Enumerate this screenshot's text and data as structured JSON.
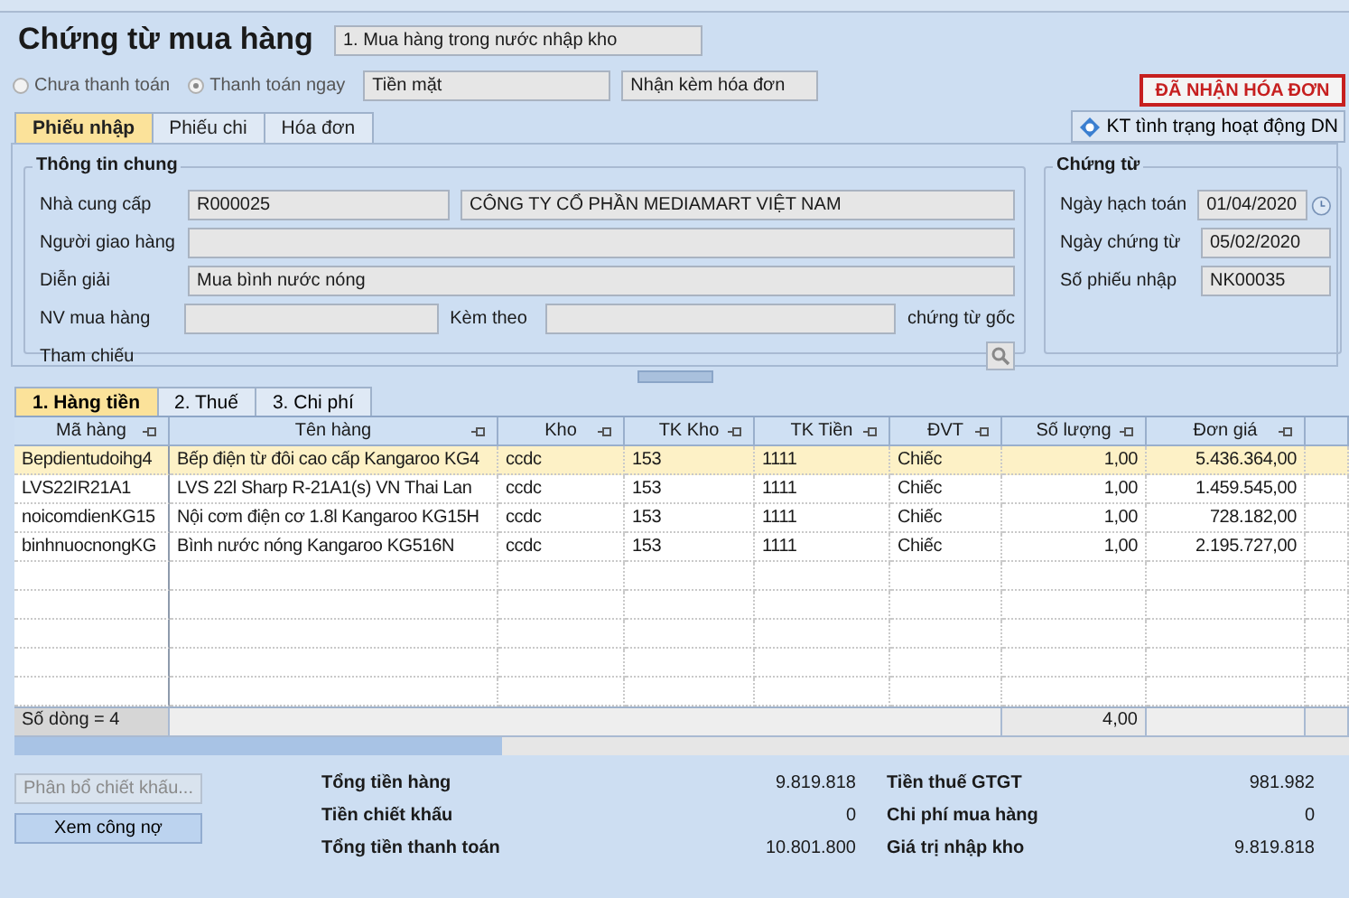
{
  "window": {
    "title": "Chứng từ mua hàng"
  },
  "voucher_type": {
    "value": "1. Mua hàng trong nước nhập kho"
  },
  "payment_options": [
    {
      "label": "Chưa thanh toán",
      "selected": false
    },
    {
      "label": "Thanh toán ngay",
      "selected": true
    }
  ],
  "payment_method": {
    "value": "Tiền mặt"
  },
  "invoice_option": {
    "value": "Nhận kèm hóa đơn"
  },
  "invoice_status_button": "ĐÃ NHẬN HÓA ĐƠN",
  "tabs": [
    {
      "label": "Phiếu nhập",
      "selected": true
    },
    {
      "label": "Phiếu chi",
      "selected": false
    },
    {
      "label": "Hóa đơn",
      "selected": false
    }
  ],
  "check_business_button": "KT tình trạng hoạt động DN",
  "general_info": {
    "title": "Thông tin chung",
    "supplier_label": "Nhà cung cấp",
    "supplier_code": "R000025",
    "supplier_name": "CÔNG TY CỔ PHẦN MEDIAMART VIỆT NAM",
    "deliverer_label": "Người giao hàng",
    "description_label": "Diễn giải",
    "description": "Mua bình nước nóng",
    "buyer_label": "NV mua hàng",
    "attached_label": "Kèm theo",
    "attached_suffix": "chứng từ gốc",
    "reference_label": "Tham chiếu"
  },
  "voucher": {
    "title": "Chứng từ",
    "fields": [
      {
        "label": "Ngày hạch toán",
        "value": "01/04/2020",
        "kind": "date"
      },
      {
        "label": "Ngày chứng từ",
        "value": "05/02/2020",
        "kind": "text"
      },
      {
        "label": "Số phiếu nhập",
        "value": "NK00035",
        "kind": "text"
      }
    ]
  },
  "grid_tabs": [
    {
      "label": "1. Hàng tiền",
      "selected": true
    },
    {
      "label": "2. Thuế",
      "selected": false
    },
    {
      "label": "3. Chi phí",
      "selected": false
    }
  ],
  "table": {
    "columns": [
      "Mã hàng",
      "Tên hàng",
      "Kho",
      "TK Kho",
      "TK Tiền",
      "ĐVT",
      "Số lượng",
      "Đơn giá"
    ],
    "rows": [
      {
        "selected": true,
        "cells": [
          "Bepdientudoihg4",
          "Bếp điện từ đôi cao cấp Kangaroo KG4",
          "ccdc",
          "153",
          "1111",
          "Chiếc",
          "1,00",
          "5.436.364,00"
        ]
      },
      {
        "selected": false,
        "cells": [
          "LVS22IR21A1",
          "LVS 22l Sharp R-21A1(s) VN Thai Lan",
          "ccdc",
          "153",
          "1111",
          "Chiếc",
          "1,00",
          "1.459.545,00"
        ]
      },
      {
        "selected": false,
        "cells": [
          "noicomdienKG15",
          "Nội cơm điện cơ 1.8l Kangaroo KG15H",
          "ccdc",
          "153",
          "1111",
          "Chiếc",
          "1,00",
          "728.182,00"
        ]
      },
      {
        "selected": false,
        "cells": [
          "binhnuocnongKG",
          "Bình nước nóng Kangaroo KG516N",
          "ccdc",
          "153",
          "1111",
          "Chiếc",
          "1,00",
          "2.195.727,00"
        ]
      }
    ],
    "row_count": "Số dòng = 4",
    "quantity_total": "4,00"
  },
  "buttons": [
    {
      "label": "Phân bổ chiết khấu...",
      "disabled": true
    },
    {
      "label": "Xem công nợ",
      "disabled": false
    }
  ],
  "totals": [
    {
      "label": "Tổng tiền hàng",
      "value": "9.819.818"
    },
    {
      "label": "Tiền thuế GTGT",
      "value": "981.982"
    },
    {
      "label": "Tiền chiết khấu",
      "value": "0"
    },
    {
      "label": "Chi phí mua hàng",
      "value": "0"
    },
    {
      "label": "Tổng tiền thanh toán",
      "value": "10.801.800"
    },
    {
      "label": "Giá trị nhập kho",
      "value": "9.819.818"
    }
  ]
}
